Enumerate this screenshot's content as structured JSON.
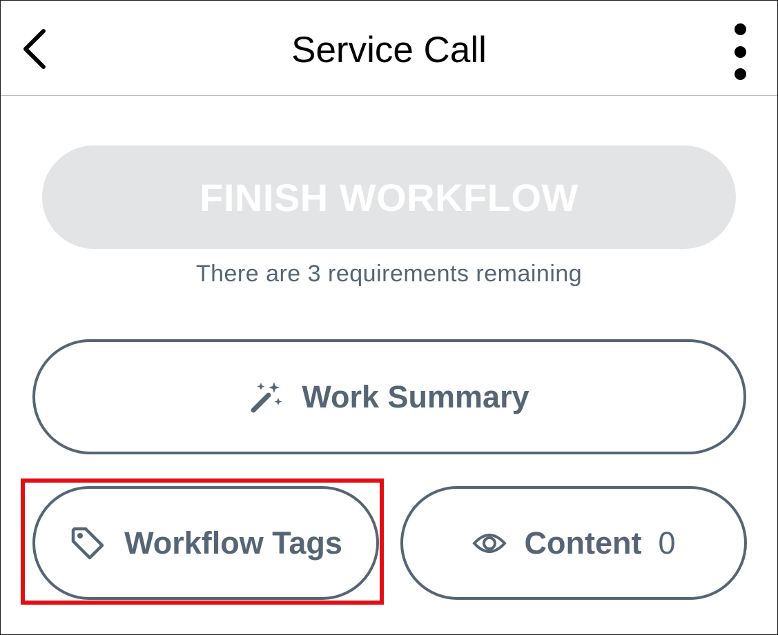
{
  "header": {
    "title": "Service Call",
    "back_icon": "chevron-left-icon",
    "more_icon": "more-vertical-icon"
  },
  "finish_button": {
    "label": "FINISH WORKFLOW",
    "disabled": true
  },
  "requirements_text": "There are 3 requirements remaining",
  "buttons": {
    "work_summary": {
      "label": "Work Summary",
      "icon": "magic-wand-icon"
    },
    "workflow_tags": {
      "label": "Workflow Tags",
      "icon": "tag-icon"
    },
    "content": {
      "label": "Content",
      "count": "0",
      "icon": "eye-icon"
    }
  },
  "colors": {
    "accent": "#566575",
    "disabled_bg": "#e3e4e6",
    "highlight": "#e10f14"
  }
}
